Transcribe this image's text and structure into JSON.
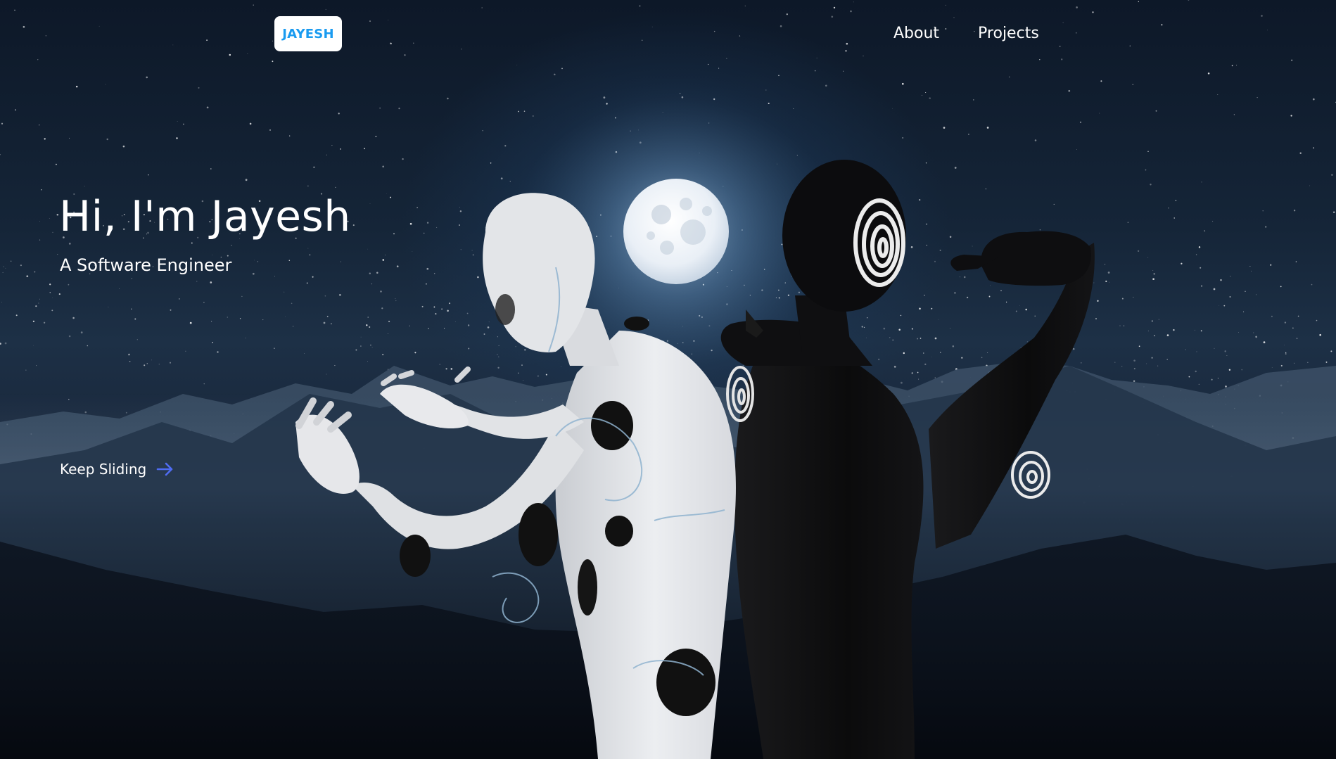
{
  "header": {
    "logo_text": "JAYESH",
    "nav": [
      {
        "label": "About"
      },
      {
        "label": "Projects"
      }
    ]
  },
  "hero": {
    "title": "Hi, I'm Jayesh",
    "subtitle": "A Software Engineer",
    "cta_label": "Keep Sliding",
    "cta_icon": "arrow-right-icon"
  },
  "colors": {
    "logo_text": "#1a9bf0",
    "arrow_accent": "#4f6cf2",
    "text": "#ffffff",
    "sky_dark": "#0b1220"
  },
  "scene": {
    "background": "night sky with stars, full moon and misty mountains",
    "figures": [
      "white-figure-with-black-spots",
      "black-figure-with-white-spirals"
    ]
  }
}
